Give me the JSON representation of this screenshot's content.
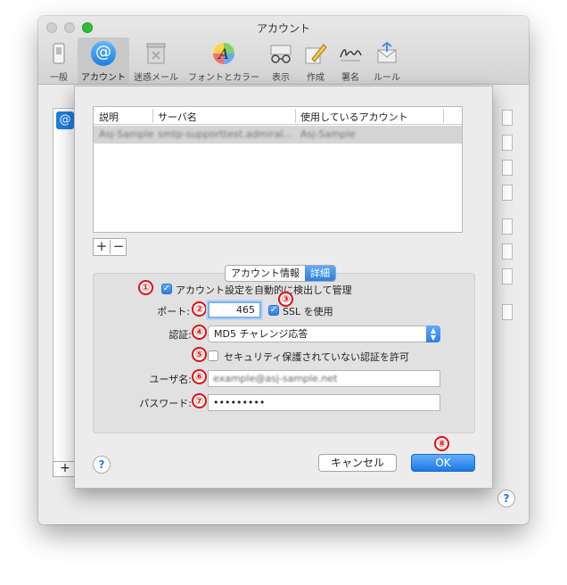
{
  "window": {
    "title": "アカウント"
  },
  "toolbar": {
    "items": [
      {
        "label": "一般",
        "icon": "switch-icon"
      },
      {
        "label": "アカウント",
        "icon": "at-icon",
        "selected": true
      },
      {
        "label": "迷惑メール",
        "icon": "junk-mail-icon"
      },
      {
        "label": "フォントとカラー",
        "icon": "font-color-icon"
      },
      {
        "label": "表示",
        "icon": "glasses-icon"
      },
      {
        "label": "作成",
        "icon": "pencil-icon"
      },
      {
        "label": "署名",
        "icon": "signature-icon"
      },
      {
        "label": "ルール",
        "icon": "rules-icon"
      }
    ]
  },
  "accounts_table": {
    "columns": [
      "説明",
      "サーバ名",
      "使用しているアカウント"
    ],
    "rows": [
      {
        "description": "Asj-Sample",
        "server": "smtp-supporttest.admiral...",
        "account": "Asj-Sample"
      }
    ]
  },
  "list_controls": {
    "add": "+",
    "remove": "−"
  },
  "tabs": [
    {
      "label": "アカウント情報",
      "active": false
    },
    {
      "label": "詳細",
      "active": true
    }
  ],
  "form": {
    "auto_manage": {
      "label": "アカウント設定を自動的に検出して管理",
      "checked": true
    },
    "port": {
      "label": "ポート:",
      "value": "465"
    },
    "ssl": {
      "label": "SSL を使用",
      "checked": true
    },
    "auth": {
      "label": "認証:",
      "value": "MD5 チャレンジ応答"
    },
    "insecure_auth": {
      "label": "セキュリティ保護されていない認証を許可",
      "checked": false
    },
    "username": {
      "label": "ユーザ名:",
      "value": "example@asj-sample.net"
    },
    "password": {
      "label": "パスワード:",
      "value": "•••••••••"
    }
  },
  "annotations": [
    "①",
    "②",
    "③",
    "④",
    "⑤",
    "⑥",
    "⑦",
    "⑧"
  ],
  "buttons": {
    "help": "?",
    "cancel": "キャンセル",
    "ok": "OK"
  },
  "colors": {
    "accent": "#2b7ee6",
    "annotation": "#e01010"
  }
}
